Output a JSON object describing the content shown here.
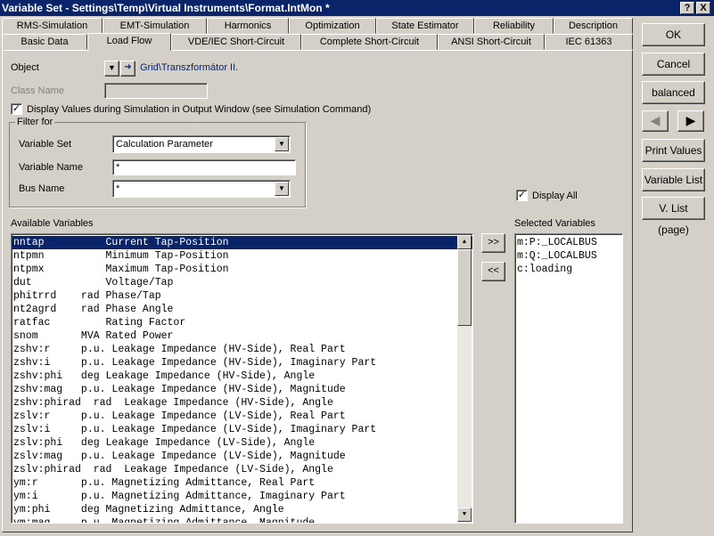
{
  "window": {
    "title": "Variable Set - Settings\\Temp\\Virtual Instruments\\Format.IntMon *",
    "help": "?",
    "close": "X"
  },
  "tabs_row1": [
    "RMS-Simulation",
    "EMT-Simulation",
    "Harmonics",
    "Optimization",
    "State Estimator",
    "Reliability",
    "Description"
  ],
  "tabs_row2": [
    "Basic Data",
    "Load Flow",
    "VDE/IEC Short-Circuit",
    "Complete Short-Circuit",
    "ANSI Short-Circuit",
    "IEC 61363"
  ],
  "active_tab": "Load Flow",
  "right_buttons": {
    "ok": "OK",
    "cancel": "Cancel",
    "balanced": "balanced",
    "prev": "◀",
    "next": "▶",
    "print": "Print Values",
    "varlist": "Variable List",
    "vlistpage": "V. List (page)"
  },
  "object": {
    "label": "Object",
    "value": "Grid\\Transzformátor II."
  },
  "class_name": {
    "label": "Class Name",
    "value": ""
  },
  "display_values": {
    "label": "Display Values during Simulation in Output Window (see Simulation Command)",
    "checked": "✓"
  },
  "filter": {
    "title": "Filter for",
    "variable_set_label": "Variable Set",
    "variable_set_value": "Calculation Parameter",
    "variable_name_label": "Variable Name",
    "variable_name_value": "*",
    "bus_name_label": "Bus Name",
    "bus_name_value": "*"
  },
  "display_all": {
    "label": "Display All",
    "checked": "✓"
  },
  "available": {
    "label": "Available Variables",
    "rows": [
      "nntap          Current Tap-Position",
      "ntpmn          Minimum Tap-Position",
      "ntpmx          Maximum Tap-Position",
      "dut            Voltage/Tap",
      "phitrrd    rad Phase/Tap",
      "nt2agrd    rad Phase Angle",
      "ratfac         Rating Factor",
      "snom       MVA Rated Power",
      "zshv:r     p.u. Leakage Impedance (HV-Side), Real Part",
      "zshv:i     p.u. Leakage Impedance (HV-Side), Imaginary Part",
      "zshv:phi   deg Leakage Impedance (HV-Side), Angle",
      "zshv:mag   p.u. Leakage Impedance (HV-Side), Magnitude",
      "zshv:phirad  rad  Leakage Impedance (HV-Side), Angle",
      "zslv:r     p.u. Leakage Impedance (LV-Side), Real Part",
      "zslv:i     p.u. Leakage Impedance (LV-Side), Imaginary Part",
      "zslv:phi   deg Leakage Impedance (LV-Side), Angle",
      "zslv:mag   p.u. Leakage Impedance (LV-Side), Magnitude",
      "zslv:phirad  rad  Leakage Impedance (LV-Side), Angle",
      "ym:r       p.u. Magnetizing Admittance, Real Part",
      "ym:i       p.u. Magnetizing Admittance, Imaginary Part",
      "ym:phi     deg Magnetizing Admittance, Angle",
      "ym:mag     p.u. Magnetizing Admittance, Magnitude"
    ]
  },
  "move_buttons": {
    "add": ">>",
    "remove": "<<"
  },
  "selected": {
    "label": "Selected Variables",
    "rows": [
      "m:P:_LOCALBUS",
      "m:Q:_LOCALBUS",
      "c:loading"
    ]
  }
}
